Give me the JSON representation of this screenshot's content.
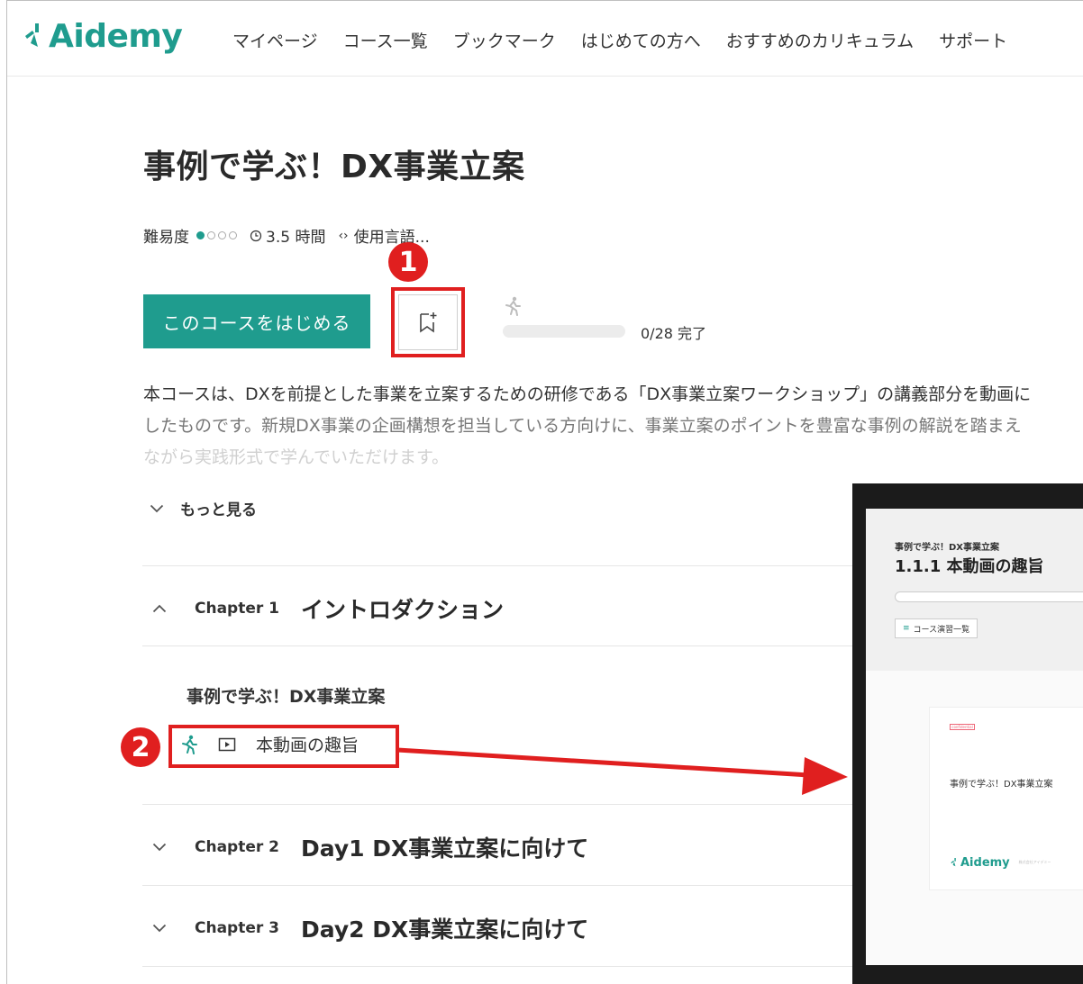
{
  "header": {
    "logo_text": "Aidemy",
    "nav": [
      "マイページ",
      "コース一覧",
      "ブックマーク",
      "はじめての方へ",
      "おすすめのカリキュラム",
      "サポート"
    ]
  },
  "course": {
    "title": "事例で学ぶ！DX事業立案",
    "difficulty_label": "難易度",
    "difficulty_level": 1,
    "difficulty_max": 4,
    "duration": "3.5 時間",
    "language_label": "使用言語..."
  },
  "actions": {
    "start_label": "このコースをはじめる",
    "progress_done": 0,
    "progress_total": 28,
    "progress_text": "0/28 完了"
  },
  "description": {
    "lines": [
      "本コースは、DXを前提とした事業を立案するための研修である「DX事業立案ワークショップ」の講義部分を動画に",
      "したものです。新規DX事業の企画構想を担当している方向けに、事業立案のポイントを豊富な事例の解説を踏まえ",
      "ながら実践形式で学んでいただけます。"
    ],
    "more_label": "もっと見る"
  },
  "chapters": [
    {
      "num": "Chapter 1",
      "title": "イントロダクション",
      "expanded": true
    },
    {
      "num": "Chapter 2",
      "title": "Day1 DX事業立案に向けて",
      "expanded": false
    },
    {
      "num": "Chapter 3",
      "title": "Day2 DX事業立案に向けて",
      "expanded": false
    }
  ],
  "chapter1_content": {
    "section_title": "事例で学ぶ！DX事業立案",
    "lesson_label": "本動画の趣旨"
  },
  "annotations": {
    "badge1": "1",
    "badge2": "2"
  },
  "preview": {
    "subtitle": "事例で学ぶ！DX事業立案",
    "title": "1.1.1 本動画の趣旨",
    "list_button": "コース演習一覧",
    "slide_tag": "confidential",
    "slide_text": "事例で学ぶ！DX事業立案",
    "slide_logo": "Aidemy",
    "slide_company": "株式会社アイデミー"
  },
  "colors": {
    "brand": "#1f9c8e",
    "annotation": "#e01f1f"
  }
}
